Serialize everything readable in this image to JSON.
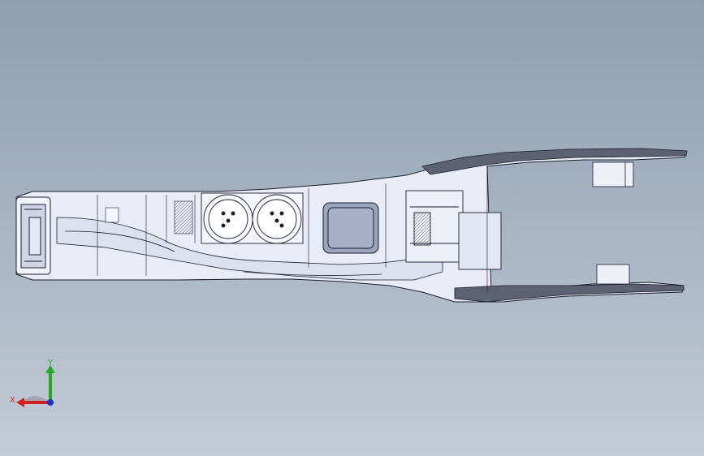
{
  "viewport": {
    "background_top": "#8e9fb1",
    "background_bottom": "#c3cbd6"
  },
  "model": {
    "description_icon": "console-assembly-wireframe",
    "line_color": "#1a1d2a",
    "fill_color": "#e9ecf6",
    "shade_color": "#b9bfd6"
  },
  "triad": {
    "x_label": "X",
    "y_label": "Y",
    "x_color": "#d62020",
    "y_color": "#22aa22",
    "z_color": "#1030d0"
  }
}
